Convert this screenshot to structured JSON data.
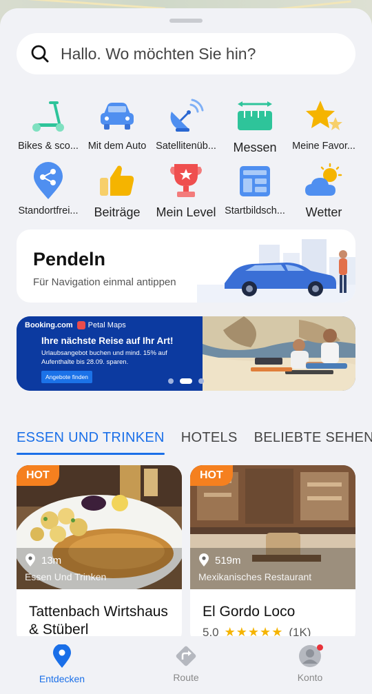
{
  "search": {
    "placeholder": "Hallo. Wo möchten Sie hin?"
  },
  "shortcuts": [
    {
      "label": "Bikes & sco...",
      "icon": "scooter-icon"
    },
    {
      "label": "Mit dem Auto",
      "icon": "car-icon"
    },
    {
      "label": "Satellitenüb...",
      "icon": "satellite-dish-icon"
    },
    {
      "label": "Messen",
      "icon": "ruler-icon"
    },
    {
      "label": "Meine Favor...",
      "icon": "star-icon"
    },
    {
      "label": "Standortfrei...",
      "icon": "share-location-icon"
    },
    {
      "label": "Beiträge",
      "icon": "thumbs-up-icon"
    },
    {
      "label": "Mein Level",
      "icon": "trophy-icon"
    },
    {
      "label": "Startbildsch...",
      "icon": "home-screen-widget-icon"
    },
    {
      "label": "Wetter",
      "icon": "weather-icon"
    }
  ],
  "pendeln": {
    "title": "Pendeln",
    "subtitle": "Für Navigation einmal antippen"
  },
  "banner": {
    "brand": "Booking.com",
    "partner": "Petal Maps",
    "headline": "Ihre nächste Reise auf Ihr Art!",
    "body": "Urlaubsangebot buchen und mind. 15% auf Aufenthalte bis 28.09. sparen.",
    "cta": "Angebote finden"
  },
  "tabs": [
    {
      "label": "ESSEN UND TRINKEN",
      "active": true
    },
    {
      "label": "HOTELS",
      "active": false
    },
    {
      "label": "BELIEBTE SEHENSWÜRDIGKEITEN",
      "active": false
    }
  ],
  "cards": [
    {
      "badge": "HOT",
      "distance": "13m",
      "category": "Essen Und Trinken",
      "name": "Tattenbach Wirtshaus & Stüberl"
    },
    {
      "badge": "HOT",
      "distance": "519m",
      "category": "Mexikanisches Restaurant",
      "name": "El Gordo Loco",
      "rating": "5.0",
      "stars": "★★★★★",
      "reviews": "(1K)"
    }
  ],
  "nav": [
    {
      "label": "Entdecken",
      "icon": "location-pin-icon",
      "active": true
    },
    {
      "label": "Route",
      "icon": "route-icon",
      "active": false
    },
    {
      "label": "Konto",
      "icon": "avatar-icon",
      "active": false
    }
  ],
  "colors": {
    "accent": "#1a6fe8",
    "hot": "#f5801f",
    "banner": "#0c3aa0"
  }
}
